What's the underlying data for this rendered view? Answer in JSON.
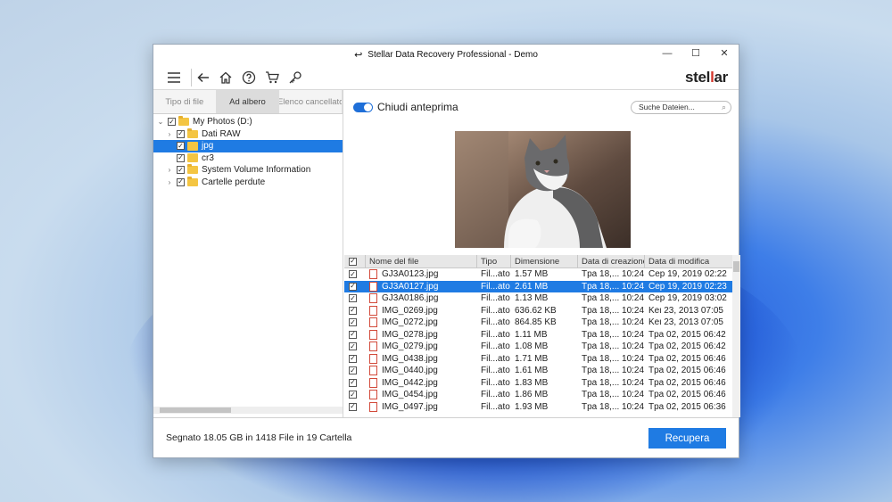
{
  "window": {
    "title": "Stellar Data Recovery Professional - Demo",
    "controls": {
      "minimize": "—",
      "maximize": "☐",
      "close": "✕"
    }
  },
  "toolbar": {
    "icons": [
      "menu-icon",
      "back-arrow-icon",
      "home-icon",
      "help-icon",
      "cart-icon",
      "key-icon"
    ],
    "brand_prefix": "stel",
    "brand_accent": "l",
    "brand_suffix": "ar"
  },
  "sidebar": {
    "tabs": [
      {
        "label": "Tipo di file",
        "active": false
      },
      {
        "label": "Ad albero",
        "active": true
      },
      {
        "label": "Elenco cancellato",
        "active": false
      }
    ],
    "tree": [
      {
        "label": "My Photos (D:)",
        "level": 0,
        "expander": "⌄",
        "checked": true,
        "icon": "folder-icon",
        "selected": false
      },
      {
        "label": "Dati RAW",
        "level": 1,
        "expander": "›",
        "checked": true,
        "icon": "folder-icon",
        "selected": false
      },
      {
        "label": "jpg",
        "level": 1,
        "expander": "",
        "checked": true,
        "icon": "file-folder-icon",
        "selected": true
      },
      {
        "label": "cr3",
        "level": 1,
        "expander": "",
        "checked": true,
        "icon": "file-folder-icon",
        "selected": false
      },
      {
        "label": "System Volume Information",
        "level": 1,
        "expander": "›",
        "checked": true,
        "icon": "folder-icon",
        "selected": false
      },
      {
        "label": "Cartelle perdute",
        "level": 1,
        "expander": "›",
        "checked": true,
        "icon": "folder-icon",
        "selected": false
      }
    ]
  },
  "preview": {
    "toggle_label": "Chiudi anteprima",
    "toggle_on": true,
    "search_placeholder": "Suche Dateien..."
  },
  "file_table": {
    "columns": [
      "Nome del file",
      "Tipo",
      "Dimensione",
      "Data di creazione",
      "Data di modifica"
    ],
    "rows": [
      {
        "name": "GJ3A0123.jpg",
        "type": "Fil...ato",
        "size": "1.57 MB",
        "created": "Tpa 18,... 10:24",
        "modified": "Cep 19, 2019 02:22",
        "selected": false
      },
      {
        "name": "GJ3A0127.jpg",
        "type": "Fil...ato",
        "size": "2.61 MB",
        "created": "Tpa 18,... 10:24",
        "modified": "Cep 19, 2019 02:23",
        "selected": true
      },
      {
        "name": "GJ3A0186.jpg",
        "type": "Fil...ato",
        "size": "1.13 MB",
        "created": "Tpa 18,... 10:24",
        "modified": "Cep 19, 2019 03:02",
        "selected": false
      },
      {
        "name": "IMG_0269.jpg",
        "type": "Fil...ato",
        "size": "636.62 KB",
        "created": "Tpa 18,... 10:24",
        "modified": "Keι 23, 2013 07:05",
        "selected": false
      },
      {
        "name": "IMG_0272.jpg",
        "type": "Fil...ato",
        "size": "864.85 KB",
        "created": "Tpa 18,... 10:24",
        "modified": "Keι 23, 2013 07:05",
        "selected": false
      },
      {
        "name": "IMG_0278.jpg",
        "type": "Fil...ato",
        "size": "1.11 MB",
        "created": "Tpa 18,... 10:24",
        "modified": "Tpa 02, 2015 06:42",
        "selected": false
      },
      {
        "name": "IMG_0279.jpg",
        "type": "Fil...ato",
        "size": "1.08 MB",
        "created": "Tpa 18,... 10:24",
        "modified": "Tpa 02, 2015 06:42",
        "selected": false
      },
      {
        "name": "IMG_0438.jpg",
        "type": "Fil...ato",
        "size": "1.71 MB",
        "created": "Tpa 18,... 10:24",
        "modified": "Tpa 02, 2015 06:46",
        "selected": false
      },
      {
        "name": "IMG_0440.jpg",
        "type": "Fil...ato",
        "size": "1.61 MB",
        "created": "Tpa 18,... 10:24",
        "modified": "Tpa 02, 2015 06:46",
        "selected": false
      },
      {
        "name": "IMG_0442.jpg",
        "type": "Fil...ato",
        "size": "1.83 MB",
        "created": "Tpa 18,... 10:24",
        "modified": "Tpa 02, 2015 06:46",
        "selected": false
      },
      {
        "name": "IMG_0454.jpg",
        "type": "Fil...ato",
        "size": "1.86 MB",
        "created": "Tpa 18,... 10:24",
        "modified": "Tpa 02, 2015 06:46",
        "selected": false
      },
      {
        "name": "IMG_0497.jpg",
        "type": "Fil...ato",
        "size": "1.93 MB",
        "created": "Tpa 18,... 10:24",
        "modified": "Tpa 02, 2015 06:36",
        "selected": false
      }
    ]
  },
  "footer": {
    "status": "Segnato 18.05 GB in 1418  File in 19 Cartella",
    "recover_label": "Recupera"
  },
  "colors": {
    "accent": "#1f7be3",
    "brand_accent": "#d4372c",
    "folder": "#f4c542"
  }
}
